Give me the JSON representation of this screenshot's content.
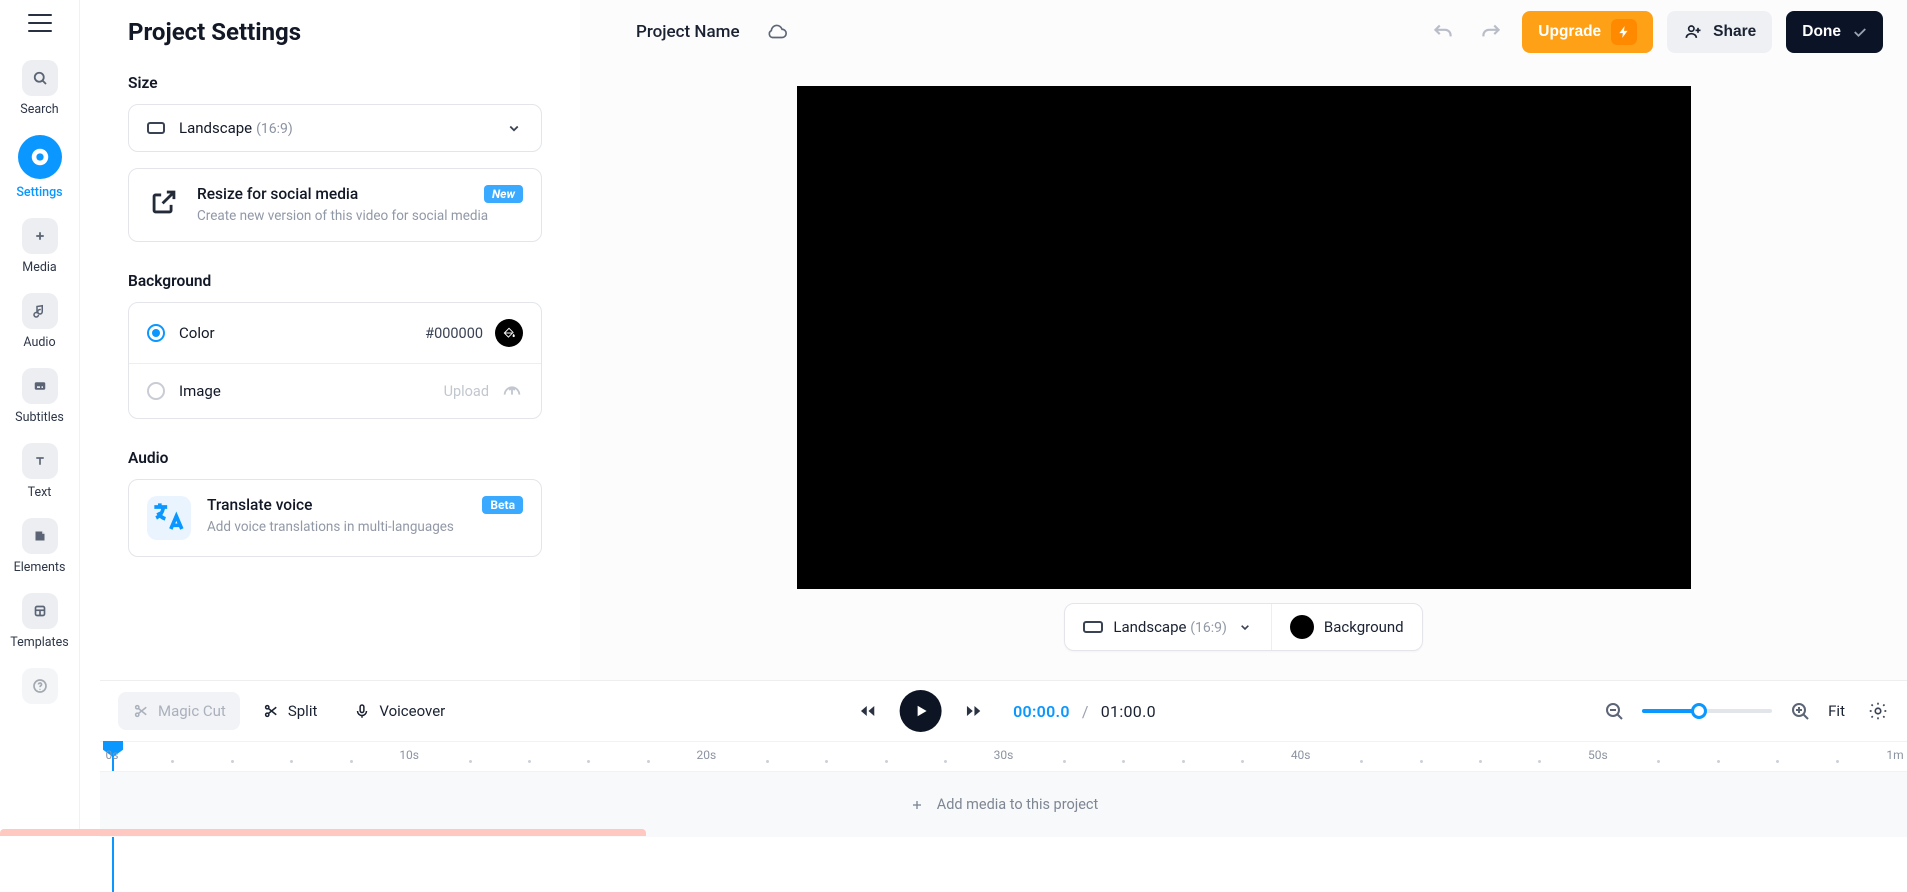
{
  "rail": {
    "items": [
      {
        "label": "Search"
      },
      {
        "label": "Settings"
      },
      {
        "label": "Media"
      },
      {
        "label": "Audio"
      },
      {
        "label": "Subtitles"
      },
      {
        "label": "Text"
      },
      {
        "label": "Elements"
      },
      {
        "label": "Templates"
      }
    ]
  },
  "panel": {
    "title": "Project Settings",
    "size_heading": "Size",
    "size_select": {
      "label": "Landscape",
      "ratio": "(16:9)"
    },
    "resize": {
      "title": "Resize for social media",
      "desc": "Create new version of this video for social media",
      "badge": "New"
    },
    "background_heading": "Background",
    "bg_color_label": "Color",
    "bg_color_hex": "#000000",
    "bg_image_label": "Image",
    "bg_image_upload": "Upload",
    "audio_heading": "Audio",
    "translate": {
      "title": "Translate voice",
      "desc": "Add voice translations in multi-languages",
      "badge": "Beta"
    }
  },
  "topbar": {
    "project_name": "Project Name",
    "upgrade": "Upgrade",
    "share": "Share",
    "done": "Done"
  },
  "canvas_bar": {
    "landscape": "Landscape",
    "ratio": "(16:9)",
    "background": "Background"
  },
  "timeline": {
    "magic_cut": "Magic Cut",
    "split": "Split",
    "voiceover": "Voiceover",
    "current": "00:00.0",
    "sep": "/",
    "duration": "01:00.0",
    "fit": "Fit",
    "ruler": [
      "0s",
      "10s",
      "20s",
      "30s",
      "40s",
      "50s",
      "1m"
    ],
    "add_media": "Add media to this project"
  }
}
